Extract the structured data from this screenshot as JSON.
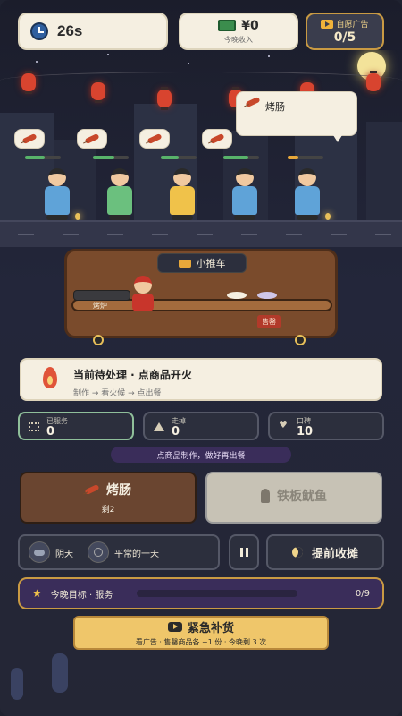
{
  "topbar": {
    "timer": "26s",
    "money": "¥0",
    "money_sub": "今晚收入",
    "ad_label": "自愿广告",
    "ad_count": "0/5"
  },
  "scene": {
    "bubble_item": "烤肠",
    "customer_colors": [
      "#5fa3d8",
      "#6bc07e",
      "#f0c24a",
      "#5fa3d8",
      "#5fa3d8"
    ],
    "patience": [
      0.55,
      0.6,
      0.5,
      0.7,
      0.3
    ]
  },
  "cart": {
    "title": "小推车",
    "grill_label": "烤炉",
    "soldout_label": "售罄"
  },
  "task": {
    "title": "当前待处理 · 点商品开火",
    "steps": "制作 → 看火候 → 点出餐"
  },
  "stats": [
    {
      "label": "已服务",
      "value": "0"
    },
    {
      "label": "走掉",
      "value": "0"
    },
    {
      "label": "口碑",
      "value": "10"
    }
  ],
  "hint": "点商品制作，做好再出餐",
  "products": [
    {
      "name": "烤肠",
      "sub": "剩2"
    },
    {
      "name": "铁板鱿鱼",
      "sub": ""
    }
  ],
  "weather": {
    "weather_label": "阴天",
    "day_label": "平常的一天"
  },
  "close_label": "提前收摊",
  "goal": {
    "label": "今晚目标 · 服务",
    "progress": 0,
    "count": "0/9"
  },
  "restock": {
    "title": "紧急补货",
    "sub": "看广告 · 售罄商品各 +1 份 · 今晚剩 3 次"
  },
  "colors": {
    "accent": "#c99a43",
    "panel": "#2c2f3d",
    "cream": "#f5efe1",
    "restock": "#efc66a"
  }
}
